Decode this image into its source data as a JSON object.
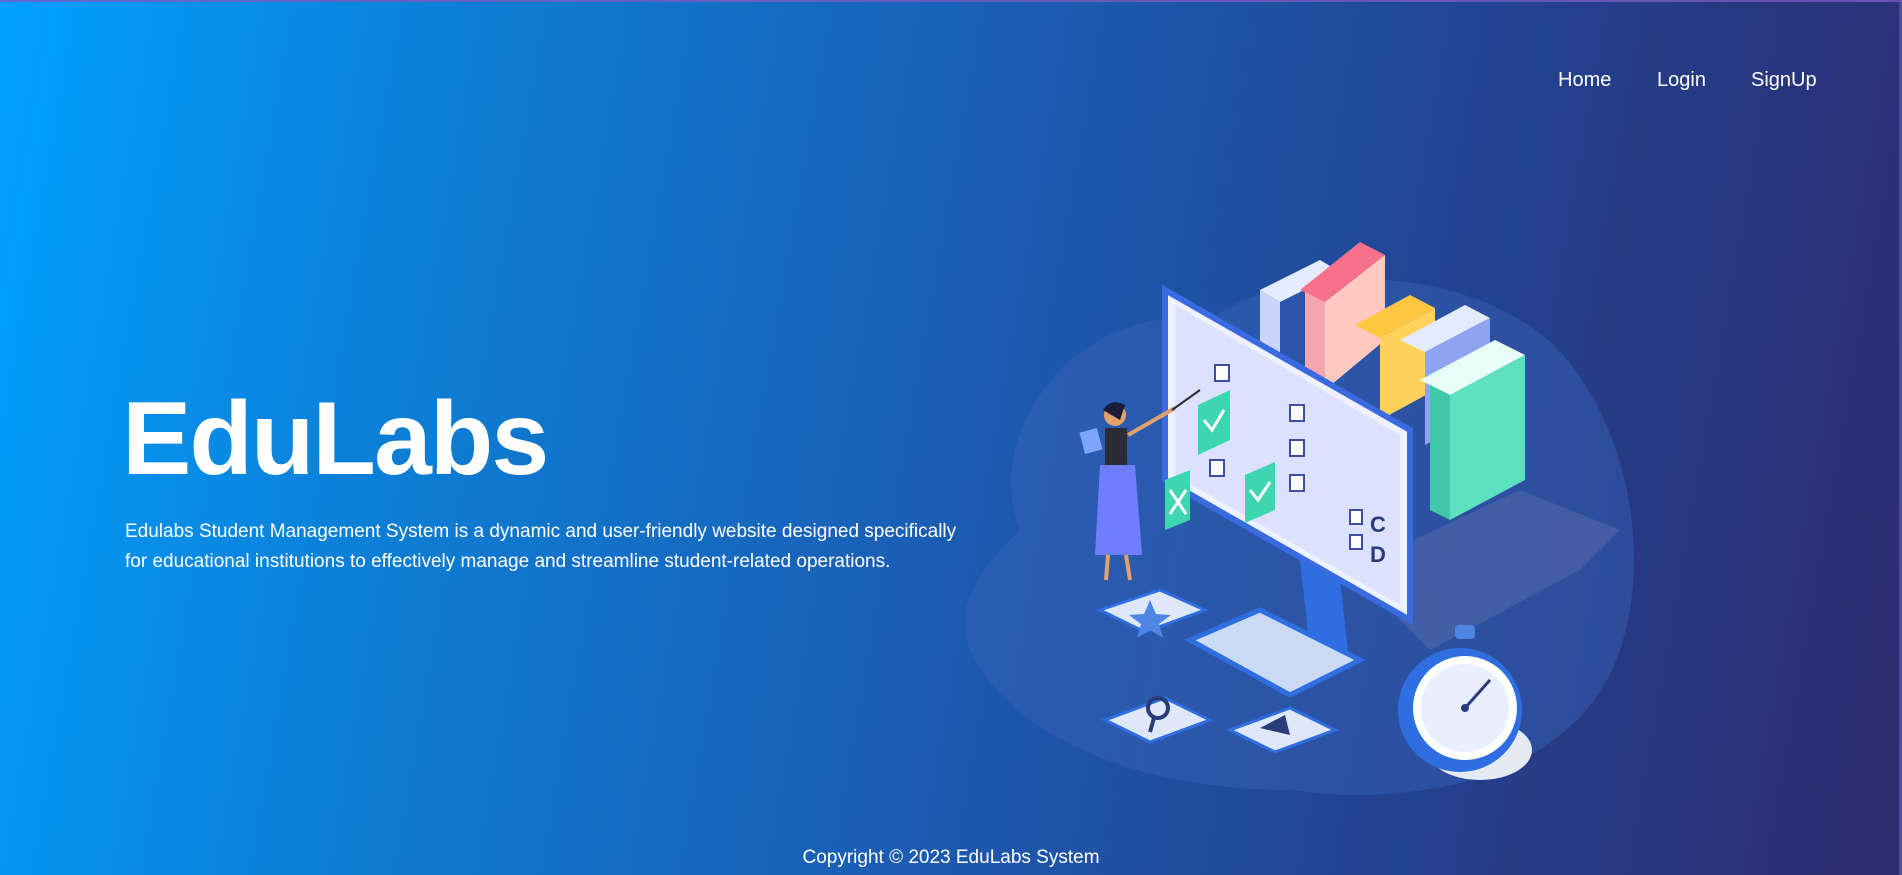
{
  "nav": {
    "items": [
      {
        "label": "Home"
      },
      {
        "label": "Login"
      },
      {
        "label": "SignUp"
      }
    ]
  },
  "hero": {
    "title": "EduLabs",
    "description": "Edulabs Student Management System is a dynamic and user-friendly website designed specifically for educational institutions to effectively manage and streamline student-related operations."
  },
  "illustration": {
    "icon": "education-illustration",
    "options_letters": [
      "C",
      "D"
    ]
  },
  "footer": {
    "copyright": "Copyright © 2023 EduLabs System"
  },
  "colors": {
    "gradient_start": "#00a0ff",
    "gradient_end": "#2d2a6e",
    "text": "#ffffff"
  }
}
